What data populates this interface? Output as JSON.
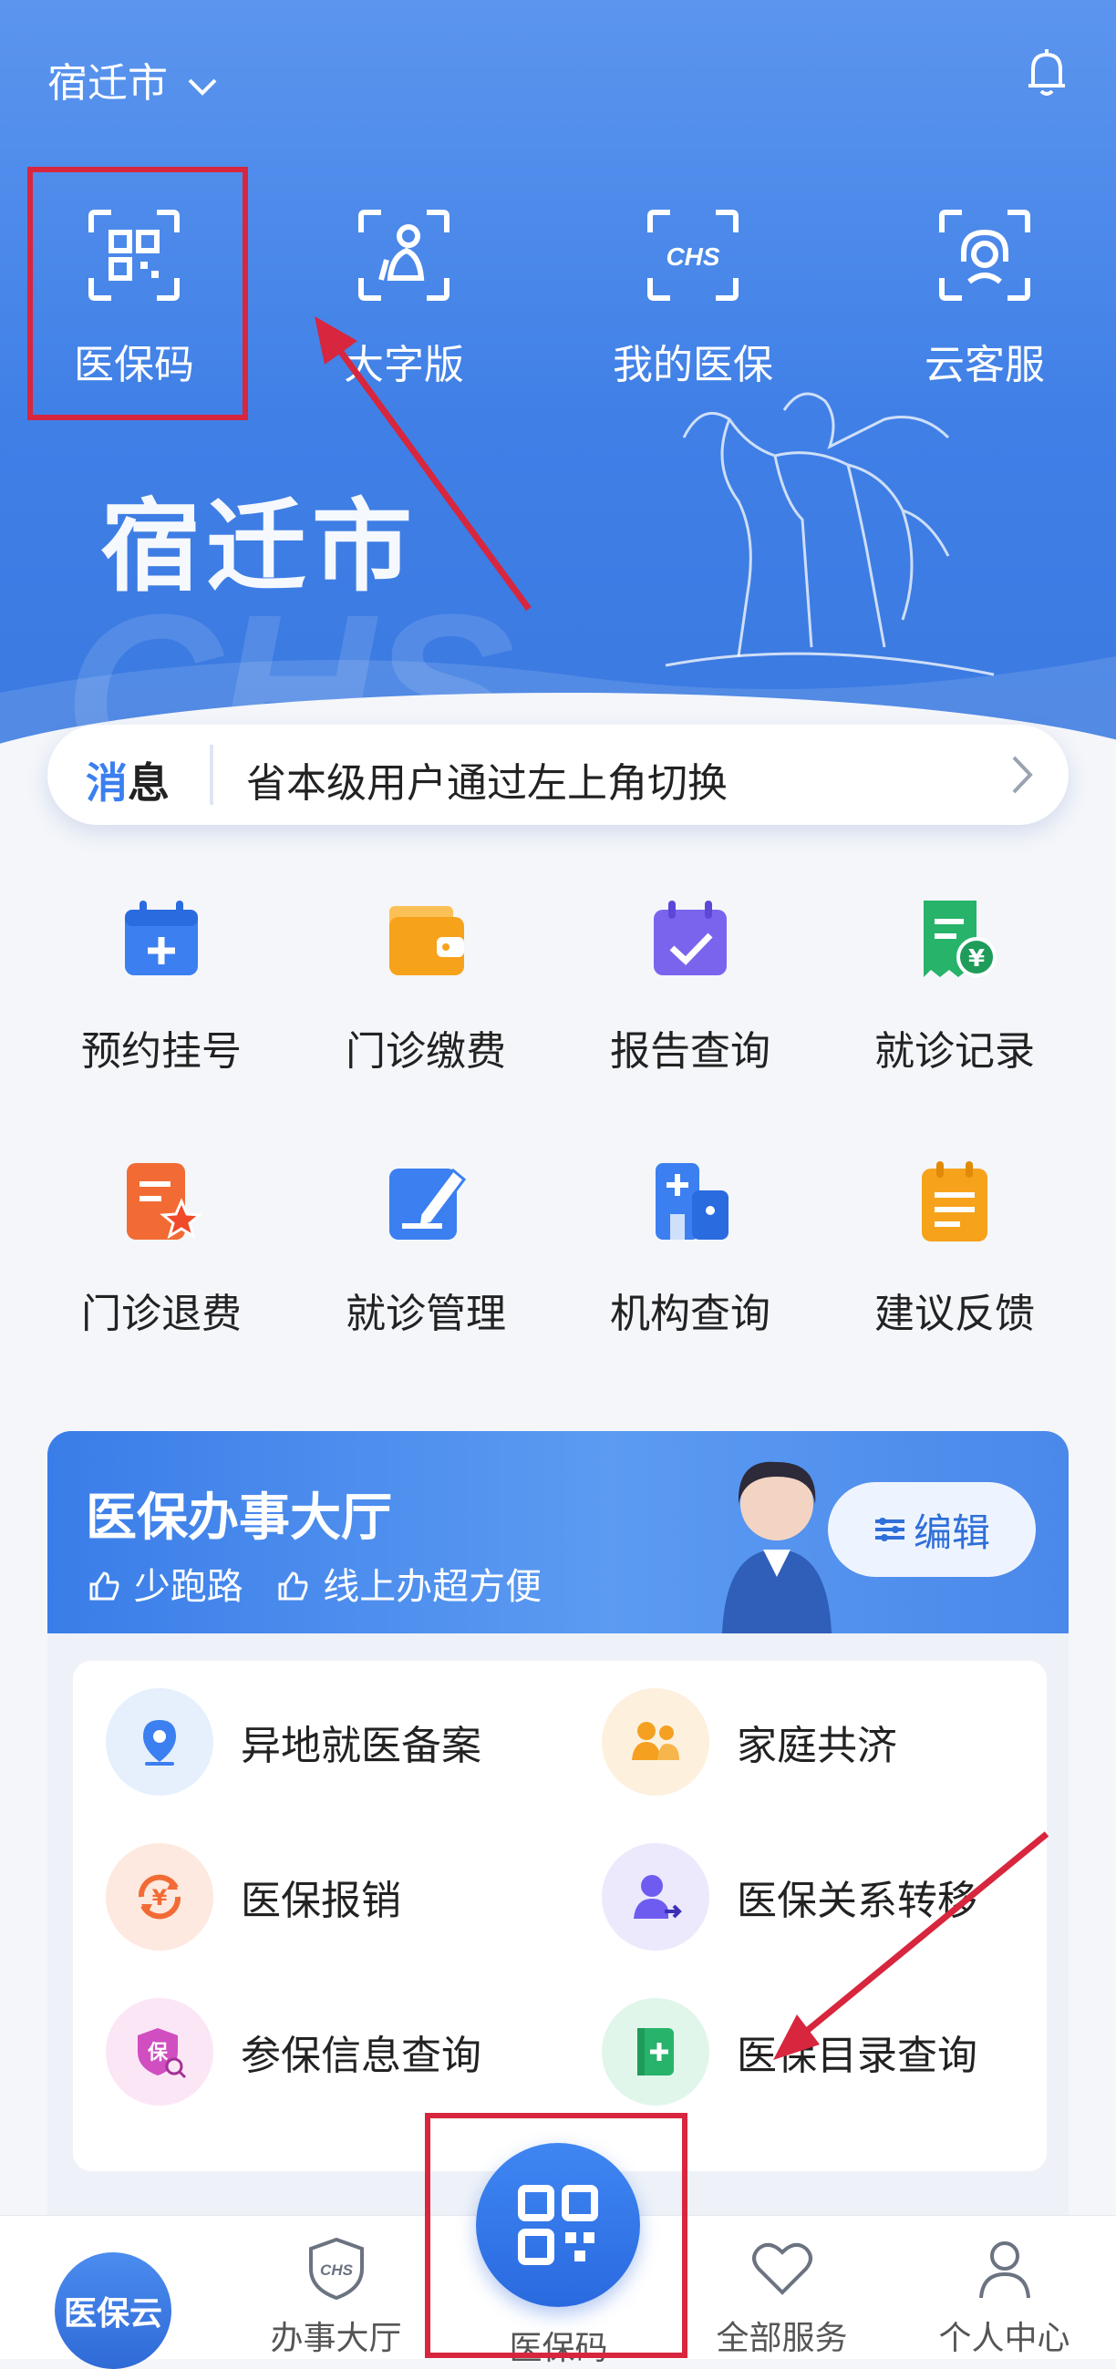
{
  "header": {
    "city": "宿迁市",
    "chevron_icon": "chevron-down-icon",
    "bell_icon": "bell-icon"
  },
  "quick_actions": [
    {
      "label": "医保码",
      "icon": "qr-code-icon"
    },
    {
      "label": "大字版",
      "icon": "elder-person-icon"
    },
    {
      "label": "我的医保",
      "icon": "chs-card-icon"
    },
    {
      "label": "云客服",
      "icon": "headset-icon"
    }
  ],
  "banner": {
    "city_title": "宿迁市",
    "watermark": "CHS"
  },
  "message": {
    "tag_part1": "消",
    "tag_part2": "息",
    "text": "省本级用户通过左上角切换"
  },
  "services": [
    {
      "label": "预约挂号",
      "icon": "calendar-plus-icon",
      "color": "#3b7ff0"
    },
    {
      "label": "门诊缴费",
      "icon": "wallet-icon",
      "color": "#f7a21b"
    },
    {
      "label": "报告查询",
      "icon": "calendar-check-icon",
      "color": "#7a64ee"
    },
    {
      "label": "就诊记录",
      "icon": "receipt-yen-icon",
      "color": "#27b36a"
    },
    {
      "label": "门诊退费",
      "icon": "document-star-icon",
      "color": "#f26b35"
    },
    {
      "label": "就诊管理",
      "icon": "edit-pen-icon",
      "color": "#3b7ff0"
    },
    {
      "label": "机构查询",
      "icon": "hospital-building-icon",
      "color": "#3b7ff0"
    },
    {
      "label": "建议反馈",
      "icon": "notepad-icon",
      "color": "#f7a21b"
    }
  ],
  "hall": {
    "title": "医保办事大厅",
    "sub1": "少跑路",
    "sub2": "线上办超方便",
    "edit_label": "编辑",
    "items": [
      {
        "label": "异地就医备案",
        "icon": "location-pin-icon",
        "bg": "#e6f0fd",
        "color": "#3b7ff0"
      },
      {
        "label": "家庭共济",
        "icon": "family-icon",
        "bg": "#fdf1de",
        "color": "#f5a020"
      },
      {
        "label": "医保报销",
        "icon": "yen-refresh-icon",
        "bg": "#fde9df",
        "color": "#f26b35"
      },
      {
        "label": "医保关系转移",
        "icon": "user-transfer-icon",
        "bg": "#ece9fd",
        "color": "#6e5cf0"
      },
      {
        "label": "参保信息查询",
        "icon": "shield-search-icon",
        "bg": "#fbe6f6",
        "color": "#d04ec0"
      },
      {
        "label": "医保目录查询",
        "icon": "medical-book-icon",
        "bg": "#e1f6ea",
        "color": "#27b36a"
      }
    ]
  },
  "tabbar": {
    "home_label": "医保云",
    "tabs": [
      {
        "label": "办事大厅",
        "icon": "chs-shield-icon"
      },
      {
        "label": "医保码",
        "icon": "qr-code-icon"
      },
      {
        "label": "全部服务",
        "icon": "heart-icon"
      },
      {
        "label": "个人中心",
        "icon": "user-icon"
      }
    ]
  },
  "colors": {
    "brand": "#3f7fe6",
    "annotation": "#d7263d"
  }
}
